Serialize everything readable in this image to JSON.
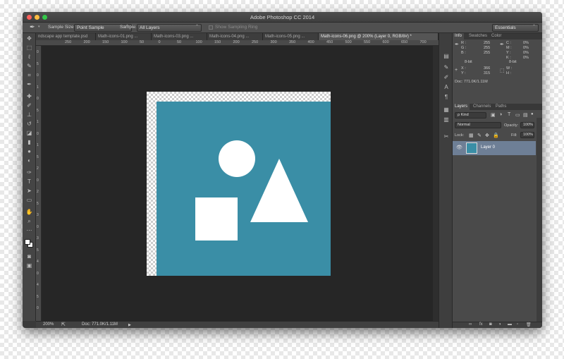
{
  "window": {
    "title": "Adobe Photoshop CC 2014",
    "traffic_lights": [
      "#fc605c",
      "#fdbc40",
      "#34c84a"
    ]
  },
  "options_bar": {
    "tool_icon": "eyedropper-icon",
    "sample_size_label": "Sample Size:",
    "sample_size_value": "Point Sample",
    "sample_label": "Sample:",
    "sample_value": "All Layers",
    "show_ring_label": "Show Sampling Ring",
    "workspace_value": "Essentials"
  },
  "tabs": [
    {
      "label": "ndscape app template.psd",
      "active": false
    },
    {
      "label": "Math-icons-01.png ...",
      "active": false
    },
    {
      "label": "Math-icons-03.png ...",
      "active": false
    },
    {
      "label": "Math-icons-04.png ...",
      "active": false
    },
    {
      "label": "Math-icons-05.png ...",
      "active": false
    },
    {
      "label": "Math-icons-06.png @ 200% (Layer 0, RGB/8#) *",
      "active": true
    }
  ],
  "ruler_top_ticks": [
    "250",
    "200",
    "150",
    "100",
    "50",
    "0",
    "50",
    "100",
    "150",
    "200",
    "250",
    "300",
    "350",
    "400",
    "450",
    "500",
    "550",
    "600",
    "650",
    "700",
    "750"
  ],
  "ruler_left_ticks": [
    "0",
    "5",
    "0",
    "1",
    "0",
    "5",
    "1",
    "0",
    "1",
    "5",
    "2",
    "0",
    "2",
    "5",
    "3",
    "0",
    "3",
    "5",
    "4",
    "0",
    "4",
    "5",
    "0"
  ],
  "document": {
    "background_color": "#3a8ea6",
    "shape_color": "#ffffff",
    "shapes": [
      "circle",
      "triangle",
      "square"
    ]
  },
  "status_bar": {
    "zoom": "200%",
    "doc_size": "Doc: 771.0K/1.11M"
  },
  "info_panel": {
    "tabs": [
      {
        "label": "Info",
        "active": true
      },
      {
        "label": "Swatches",
        "active": false
      },
      {
        "label": "Color",
        "active": false
      }
    ],
    "rgb": {
      "r_label": "R :",
      "r": "255",
      "g_label": "G :",
      "g": "255",
      "b_label": "B :",
      "b": "255"
    },
    "cmyk": {
      "c_label": "C :",
      "c": "0%",
      "m_label": "M :",
      "m": "0%",
      "y_label": "Y :",
      "y": "0%",
      "k_label": "K :",
      "k": "0%"
    },
    "bit_left": "8-bit",
    "bit_right": "8-bit",
    "x_label": "X :",
    "x": "366",
    "y_label": "Y :",
    "y": "315",
    "w_label": "W :",
    "h_label": "H :",
    "doc": "Doc: 771.0K/1.11M"
  },
  "layers_panel": {
    "tabs": [
      {
        "label": "Layers",
        "active": true
      },
      {
        "label": "Channels",
        "active": false
      },
      {
        "label": "Paths",
        "active": false
      }
    ],
    "kind_value": "ρ Kind",
    "blend_mode": "Normal",
    "opacity_label": "Opacity:",
    "opacity_value": "100%",
    "lock_label": "Lock:",
    "fill_label": "Fill:",
    "fill_value": "100%",
    "layers": [
      {
        "name": "Layer 0",
        "selected": true
      }
    ],
    "footer_icons": [
      "link-icon",
      "fx-icon",
      "mask-icon",
      "adjustment-icon",
      "group-icon",
      "new-layer-icon",
      "trash-icon"
    ]
  },
  "tools": [
    "move-icon",
    "marquee-icon",
    "lasso-icon",
    "quick-select-icon",
    "crop-icon",
    "eyedropper-icon",
    "healing-icon",
    "brush-icon",
    "stamp-icon",
    "history-brush-icon",
    "eraser-icon",
    "gradient-icon",
    "blur-icon",
    "dodge-icon",
    "pen-icon",
    "type-icon",
    "path-select-icon",
    "rectangle-icon",
    "hand-icon",
    "zoom-icon",
    "more-tools-icon",
    "color-swatches-icon",
    "quick-mask-icon",
    "screen-mode-icon"
  ]
}
